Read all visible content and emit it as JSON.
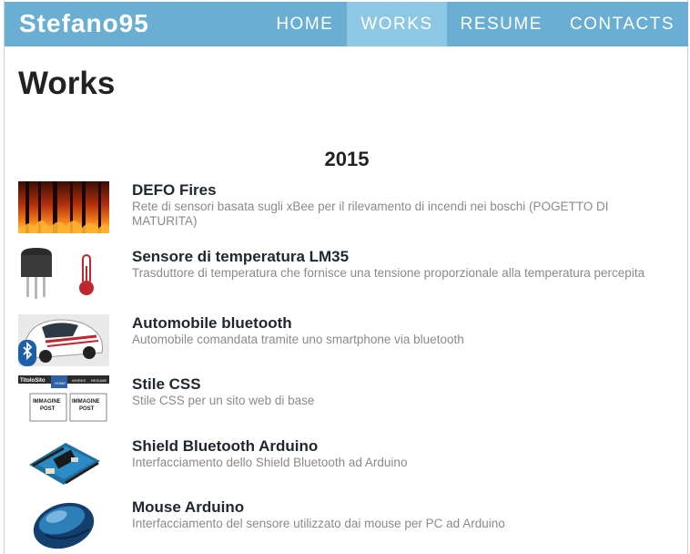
{
  "header": {
    "brand": "Stefano95",
    "nav": [
      {
        "label": "HOME",
        "active": false
      },
      {
        "label": "WORKS",
        "active": true
      },
      {
        "label": "RESUME",
        "active": false
      },
      {
        "label": "CONTACTS",
        "active": false
      }
    ]
  },
  "page": {
    "title": "Works"
  },
  "section": {
    "year": "2015",
    "items": [
      {
        "title": "DEFO Fires",
        "description": "Rete di sensori basata sugli xBee per il rilevamento di incendi nei boschi (POGETTO DI MATURITA)",
        "icon": "forest-fire-image"
      },
      {
        "title": "Sensore di temperatura LM35",
        "description": "Trasduttore di temperatura che fornisce una tensione proporzionale alla temperatura percepita",
        "icon": "temperature-sensor-image"
      },
      {
        "title": "Automobile bluetooth",
        "description": "Automobile comandata tramite uno smartphone via bluetooth",
        "icon": "bluetooth-car-image"
      },
      {
        "title": "Stile CSS",
        "description": "Stile CSS per un sito web di base",
        "icon": "css-mockup-image",
        "thumb_text": {
          "site_title": "TitoloSito",
          "nav": [
            "HOME",
            "WORKS",
            "RESUME"
          ],
          "box1": [
            "IMMAGINE",
            "POST"
          ],
          "box2": [
            "IMMAGINE",
            "POST"
          ]
        }
      },
      {
        "title": "Shield Bluetooth Arduino",
        "description": "Interfacciamento dello Shield Bluetooth ad Arduino",
        "icon": "arduino-shield-image"
      },
      {
        "title": "Mouse Arduino",
        "description": "Interfacciamento del sensore utilizzato dai mouse per PC ad Arduino",
        "icon": "mouse-image"
      }
    ]
  },
  "colors": {
    "navbar": "#6aaed3",
    "nav_active": "#8ec7e4",
    "title_text": "#222222",
    "description_text": "#8a8a8a"
  }
}
